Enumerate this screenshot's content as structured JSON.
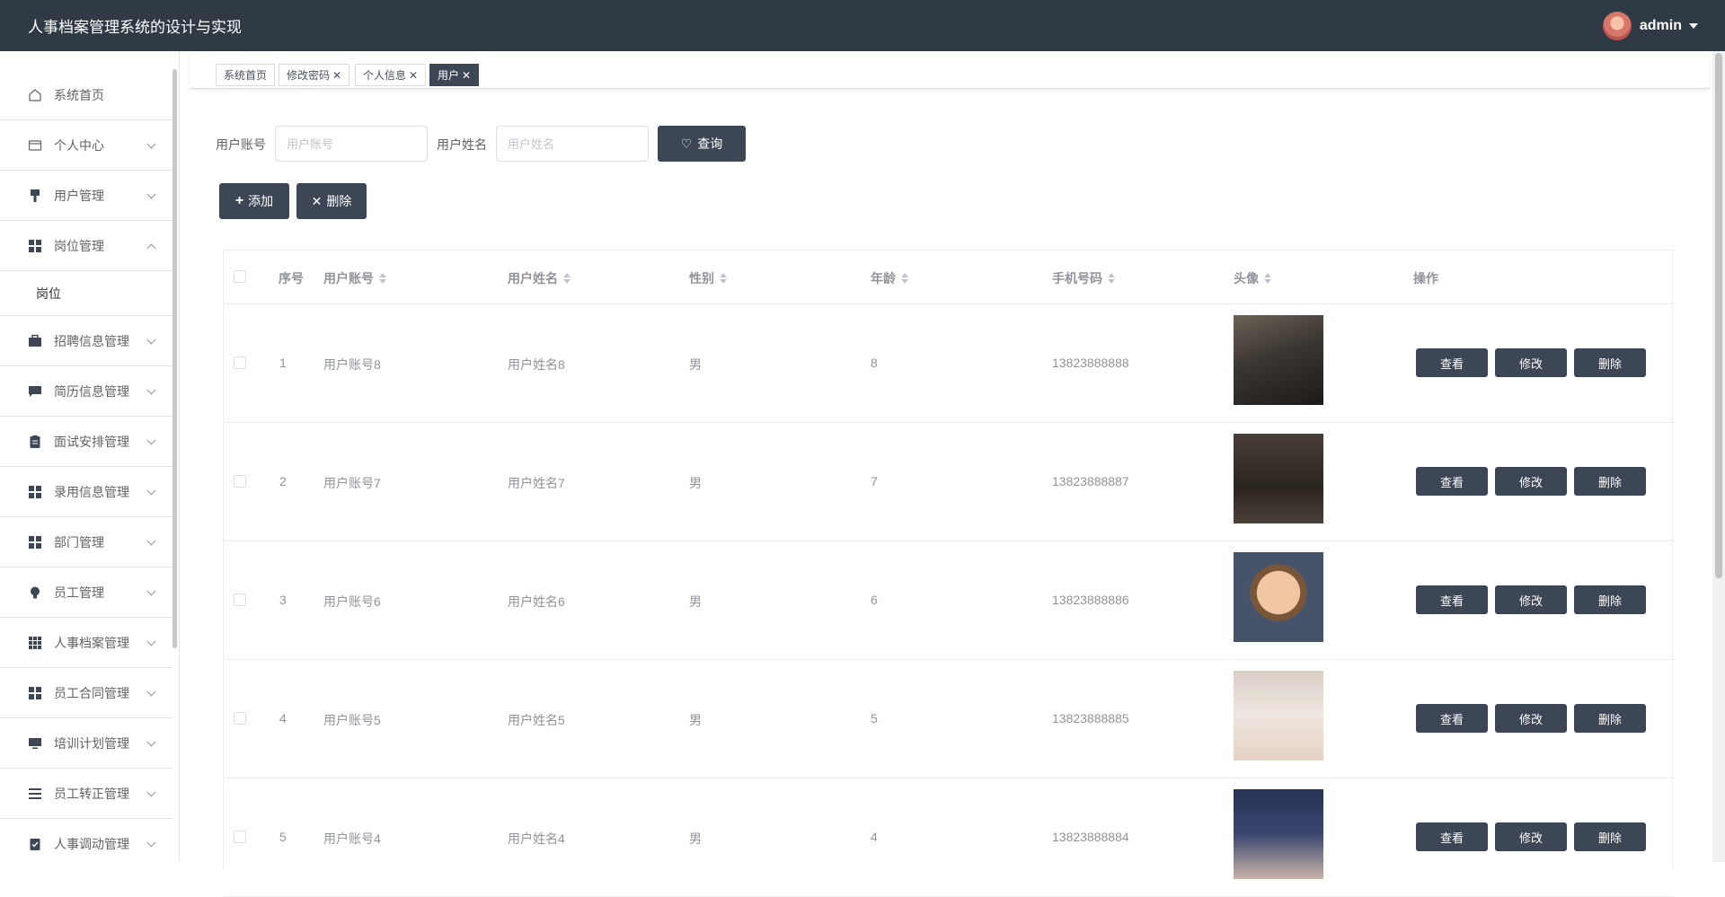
{
  "header": {
    "title": "人事档案管理系统的设计与实现",
    "user": "admin"
  },
  "sidebar": {
    "items": [
      {
        "label": "系统首页",
        "icon": "home-icon"
      },
      {
        "label": "个人中心",
        "icon": "wallet-icon"
      },
      {
        "label": "用户管理",
        "icon": "brush-icon"
      },
      {
        "label": "岗位管理",
        "icon": "grid-icon",
        "expanded": true
      },
      {
        "label": "招聘信息管理",
        "icon": "briefcase-icon"
      },
      {
        "label": "简历信息管理",
        "icon": "message-icon"
      },
      {
        "label": "面试安排管理",
        "icon": "clipboard-icon"
      },
      {
        "label": "录用信息管理",
        "icon": "grid-icon"
      },
      {
        "label": "部门管理",
        "icon": "grid-icon"
      },
      {
        "label": "员工管理",
        "icon": "bulb-icon"
      },
      {
        "label": "人事档案管理",
        "icon": "apps-icon"
      },
      {
        "label": "员工合同管理",
        "icon": "grid-icon"
      },
      {
        "label": "培训计划管理",
        "icon": "monitor-icon"
      },
      {
        "label": "员工转正管理",
        "icon": "list-icon"
      },
      {
        "label": "人事调动管理",
        "icon": "checklist-icon"
      }
    ],
    "subitem": "岗位"
  },
  "tabs": [
    {
      "label": "系统首页",
      "closable": false
    },
    {
      "label": "修改密码",
      "closable": true
    },
    {
      "label": "个人信息",
      "closable": true
    },
    {
      "label": "用户",
      "closable": true,
      "active": true
    }
  ],
  "search": {
    "account_label": "用户账号",
    "account_placeholder": "用户账号",
    "name_label": "用户姓名",
    "name_placeholder": "用户姓名",
    "query_button": "查询"
  },
  "actions": {
    "add": "添加",
    "delete": "删除"
  },
  "table": {
    "columns": [
      "序号",
      "用户账号",
      "用户姓名",
      "性别",
      "年龄",
      "手机号码",
      "头像",
      "操作"
    ],
    "rows": [
      {
        "index": "1",
        "account": "用户账号8",
        "name": "用户姓名8",
        "gender": "男",
        "age": "8",
        "phone": "13823888888"
      },
      {
        "index": "2",
        "account": "用户账号7",
        "name": "用户姓名7",
        "gender": "男",
        "age": "7",
        "phone": "13823888887"
      },
      {
        "index": "3",
        "account": "用户账号6",
        "name": "用户姓名6",
        "gender": "男",
        "age": "6",
        "phone": "13823888886"
      },
      {
        "index": "4",
        "account": "用户账号5",
        "name": "用户姓名5",
        "gender": "男",
        "age": "5",
        "phone": "13823888885"
      },
      {
        "index": "5",
        "account": "用户账号4",
        "name": "用户姓名4",
        "gender": "男",
        "age": "4",
        "phone": "13823888884"
      }
    ],
    "row_buttons": {
      "view": "查看",
      "edit": "修改",
      "delete": "删除"
    }
  },
  "colors": {
    "header_bg": "#2f3a45",
    "button_bg": "#3d4654",
    "accent_tab": "#3d4654"
  }
}
